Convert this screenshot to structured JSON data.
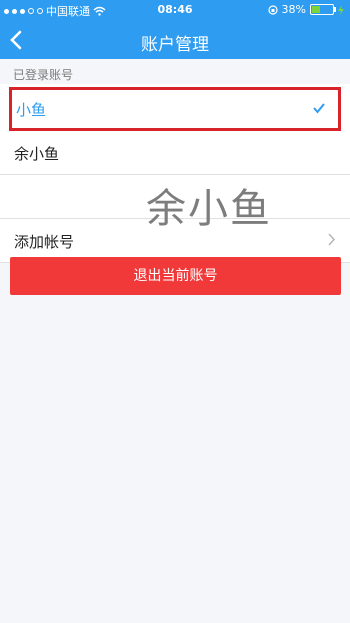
{
  "status": {
    "carrier": "中国联通",
    "time": "08:46",
    "battery": "38%",
    "battery_level": 0.38
  },
  "nav": {
    "title": "账户管理"
  },
  "accounts": {
    "section_label": "已登录账号",
    "items": [
      {
        "name": "小鱼",
        "selected": true
      },
      {
        "name": "余小鱼",
        "selected": false
      }
    ],
    "add_label": "添加帐号"
  },
  "watermark": "余小鱼",
  "logout_label": "退出当前账号",
  "colors": {
    "accent": "#2e9cf1",
    "danger": "#f2393a",
    "highlight": "#d9232a"
  }
}
